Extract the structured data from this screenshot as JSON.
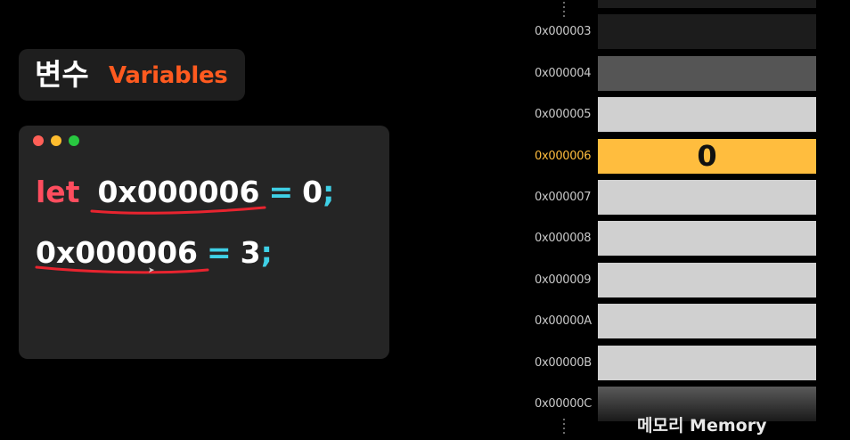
{
  "title": {
    "korean": "변수",
    "english": "Variables",
    "english_color": "#ff5a1f"
  },
  "window_controls": {
    "close_color": "#ff5f57",
    "minimize_color": "#febc2e",
    "maximize_color": "#28c840"
  },
  "code": {
    "line1": {
      "keyword": "let",
      "address": "0x000006",
      "operator": "=",
      "value": "0",
      "semicolon": ";"
    },
    "line2": {
      "address": "0x000006",
      "operator": "=",
      "value": "3",
      "semicolon": ";"
    },
    "colors": {
      "keyword": "#ff4d5e",
      "text": "#ffffff",
      "operator": "#3fd0e6",
      "underline": "#e8242f"
    }
  },
  "memory": {
    "caption": "메모리 Memory",
    "highlight_color": "#ffbd3e",
    "cells": [
      {
        "address": "",
        "value": "",
        "color": "#1c1c1c"
      },
      {
        "address": "0x000003",
        "value": "",
        "color": "#1c1c1c"
      },
      {
        "address": "0x000004",
        "value": "",
        "color": "#555555"
      },
      {
        "address": "0x000005",
        "value": "",
        "color": "#d0d0d0"
      },
      {
        "address": "0x000006",
        "value": "0",
        "color": "#ffbd3e"
      },
      {
        "address": "0x000007",
        "value": "",
        "color": "#d0d0d0"
      },
      {
        "address": "0x000008",
        "value": "",
        "color": "#d0d0d0"
      },
      {
        "address": "0x000009",
        "value": "",
        "color": "#d0d0d0"
      },
      {
        "address": "0x00000A",
        "value": "",
        "color": "#d0d0d0"
      },
      {
        "address": "0x00000B",
        "value": "",
        "color": "#d0d0d0"
      },
      {
        "address": "0x00000C",
        "value": "",
        "color": "#5a5a5a"
      }
    ]
  }
}
